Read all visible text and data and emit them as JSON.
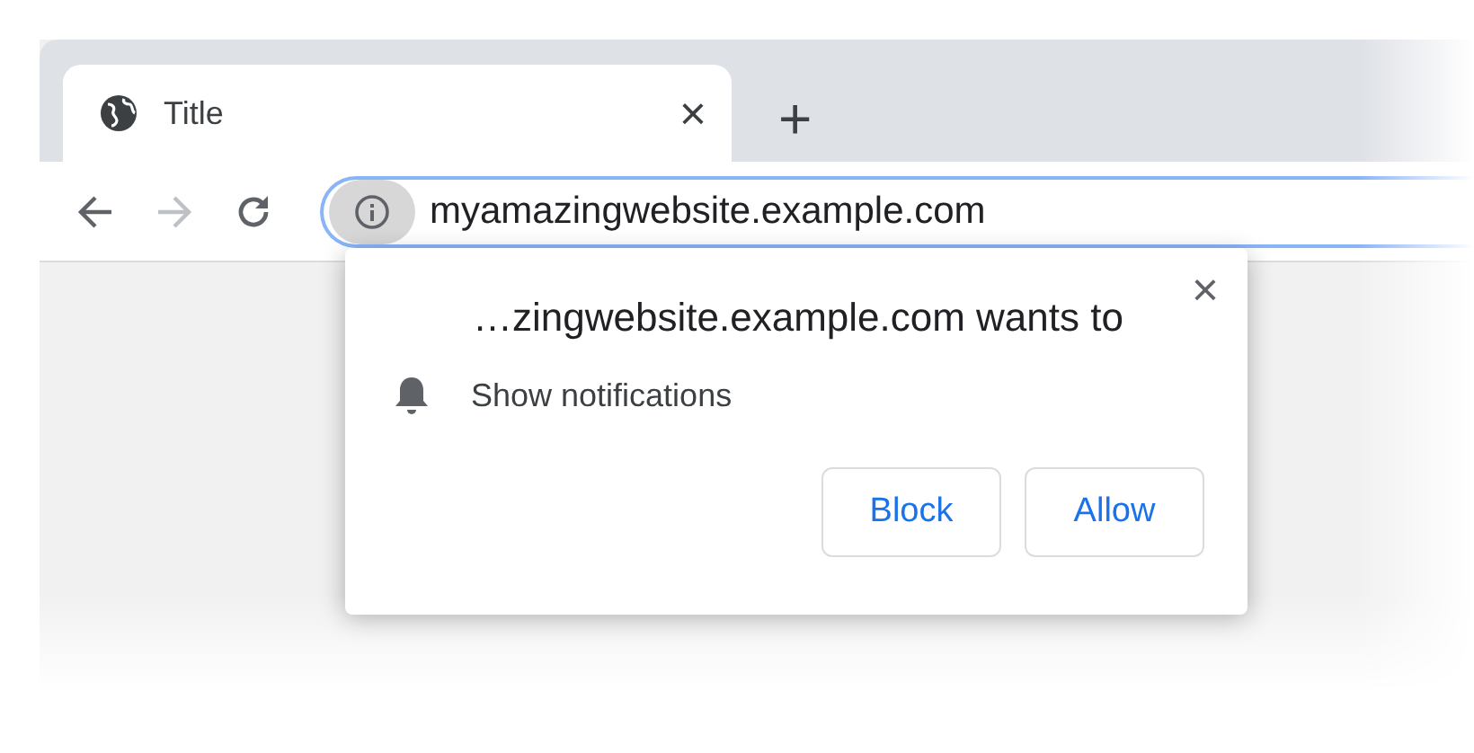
{
  "tabs": [
    {
      "title": "Title",
      "close": "×"
    }
  ],
  "new_tab": "+",
  "toolbar": {
    "buttons": [
      {
        "kind": "back",
        "disabled": false
      },
      {
        "kind": "forward",
        "disabled": true
      },
      {
        "kind": "reload",
        "disabled": false
      }
    ]
  },
  "address_bar": {
    "value": "myamazingwebsite.example.com"
  },
  "permission_popup": {
    "title": "…zingwebsite.example.com wants to",
    "close": "×",
    "permission": "Show notifications",
    "buttons": [
      "Block",
      "Allow"
    ]
  }
}
